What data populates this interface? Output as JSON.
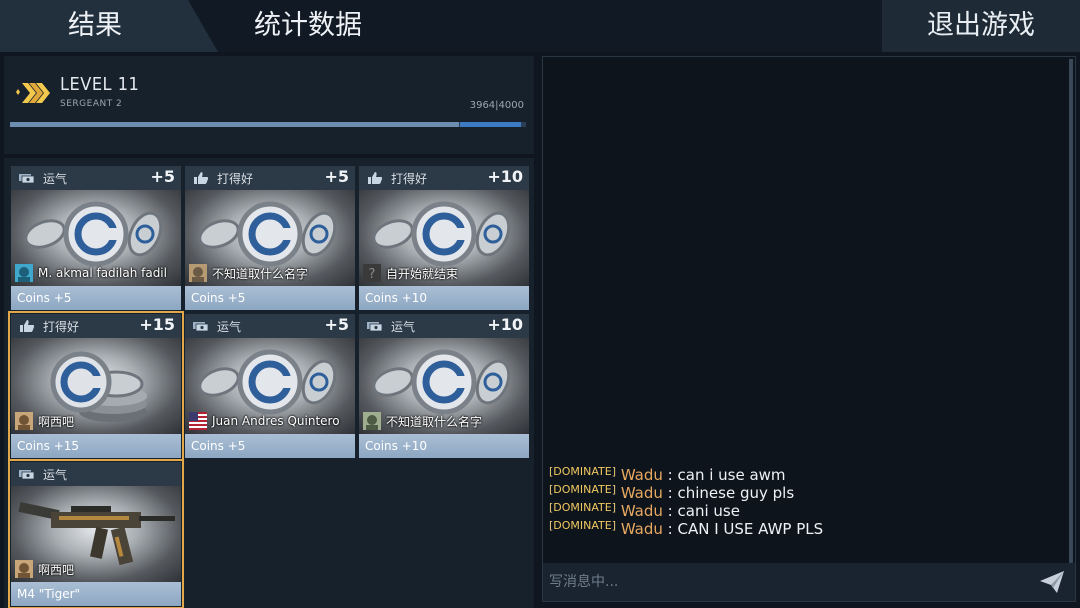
{
  "tabs": {
    "results": "结果",
    "stats": "统计数据",
    "exit": "退出游戏"
  },
  "level": {
    "title": "LEVEL 11",
    "rank": "SERGEANT 2",
    "xp_text": "3964|4000",
    "xp_current": 3964,
    "xp_max": 4000
  },
  "cards": [
    {
      "category": "运气",
      "category_icon": "money-icon",
      "bonus": "+5",
      "player": "M. akmal fadilah fadil",
      "reward": "Coins +5",
      "item": "coins",
      "highlight": false
    },
    {
      "category": "打得好",
      "category_icon": "thumbs-up-icon",
      "bonus": "+5",
      "player": "不知道取什么名字",
      "reward": "Coins +5",
      "item": "coins",
      "highlight": false
    },
    {
      "category": "打得好",
      "category_icon": "thumbs-up-icon",
      "bonus": "+10",
      "player": "自开始就结束",
      "reward": "Coins +10",
      "item": "coins",
      "highlight": false
    },
    {
      "category": "打得好",
      "category_icon": "thumbs-up-icon",
      "bonus": "+15",
      "player": "啊西吧",
      "reward": "Coins +15",
      "item": "coins-stack",
      "highlight": true
    },
    {
      "category": "运气",
      "category_icon": "money-icon",
      "bonus": "+5",
      "player": "Juan Andres Quintero",
      "reward": "Coins +5",
      "item": "coins",
      "highlight": false
    },
    {
      "category": "运气",
      "category_icon": "money-icon",
      "bonus": "+10",
      "player": "不知道取什么名字",
      "reward": "Coins +10",
      "item": "coins",
      "highlight": false
    },
    {
      "category": "运气",
      "category_icon": "money-icon",
      "bonus": "",
      "player": "啊西吧",
      "reward": "M4 \"Tiger\"",
      "item": "rifle",
      "highlight": true
    }
  ],
  "chat": {
    "messages": [
      {
        "tag": "DOMINATE",
        "user": "Wadu",
        "text": "can i use awm"
      },
      {
        "tag": "DOMINATE",
        "user": "Wadu",
        "text": "chinese guy pls"
      },
      {
        "tag": "DOMINATE",
        "user": "Wadu",
        "text": "cani use"
      },
      {
        "tag": "DOMINATE",
        "user": "Wadu",
        "text": "CAN I USE AWP PLS"
      }
    ],
    "placeholder": "写消息中..."
  },
  "colors": {
    "highlight": "#e0a84a",
    "chat_user": "#e8a860",
    "chat_tag": "#f0c860",
    "xp_bar": "#3d7ac4"
  }
}
